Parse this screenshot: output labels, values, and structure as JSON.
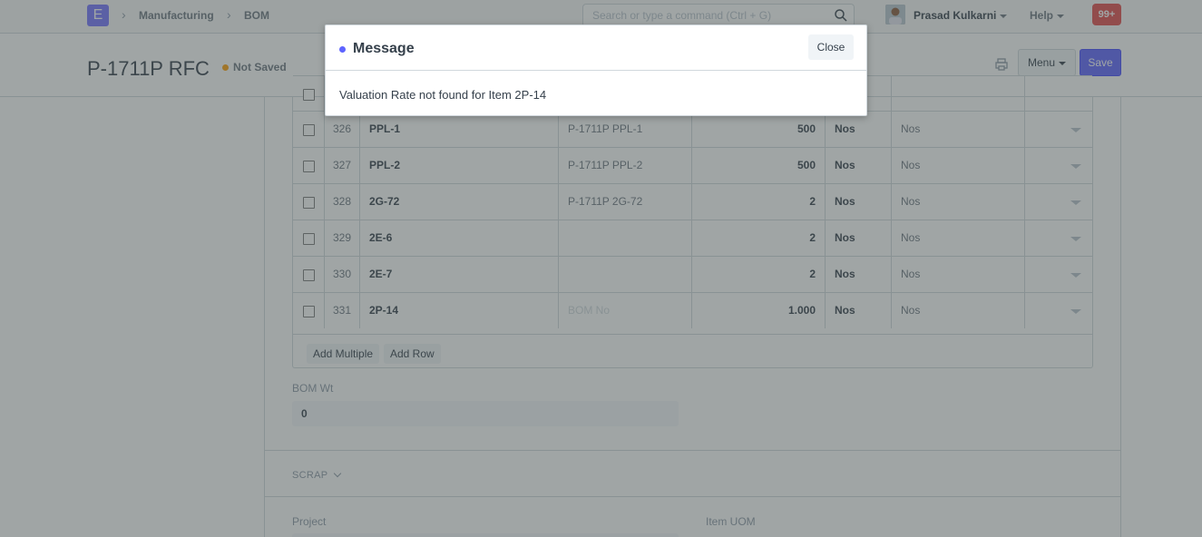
{
  "navbar": {
    "logo": "E",
    "breadcrumbs": [
      "Manufacturing",
      "BOM"
    ],
    "search_placeholder": "Search or type a command (Ctrl + G)",
    "user_name": "Prasad Kulkarni",
    "help_label": "Help",
    "notification_count": "99+"
  },
  "page": {
    "title": "P-1711P RFC",
    "status": "Not Saved",
    "menu_label": "Menu",
    "save_label": "Save"
  },
  "items_grid": {
    "rows": [
      {
        "idx": "326",
        "item_code": "PPL-1",
        "bom_no": "P-1711P PPL-1",
        "qty": "500",
        "uom": "Nos",
        "stock_uom": "Nos"
      },
      {
        "idx": "327",
        "item_code": "PPL-2",
        "bom_no": "P-1711P PPL-2",
        "qty": "500",
        "uom": "Nos",
        "stock_uom": "Nos"
      },
      {
        "idx": "328",
        "item_code": "2G-72",
        "bom_no": "P-1711P 2G-72",
        "qty": "2",
        "uom": "Nos",
        "stock_uom": "Nos"
      },
      {
        "idx": "329",
        "item_code": "2E-6",
        "bom_no": "",
        "qty": "2",
        "uom": "Nos",
        "stock_uom": "Nos"
      },
      {
        "idx": "330",
        "item_code": "2E-7",
        "bom_no": "",
        "qty": "2",
        "uom": "Nos",
        "stock_uom": "Nos"
      },
      {
        "idx": "331",
        "item_code": "2P-14",
        "bom_no": "BOM No",
        "qty": "1.000",
        "uom": "Nos",
        "stock_uom": "Nos"
      }
    ],
    "add_multiple_label": "Add Multiple",
    "add_row_label": "Add Row"
  },
  "fields": {
    "bom_wt_label": "BOM Wt",
    "bom_wt_value": "0",
    "scrap_section": "SCRAP",
    "project_label": "Project",
    "item_uom_label": "Item UOM"
  },
  "dialog": {
    "title": "Message",
    "close_label": "Close",
    "message": "Valuation Rate not found for Item 2P-14"
  },
  "colors": {
    "primary": "#5e64ff",
    "not_saved_indicator": "#ffa00a",
    "notification": "#e24c4c"
  }
}
